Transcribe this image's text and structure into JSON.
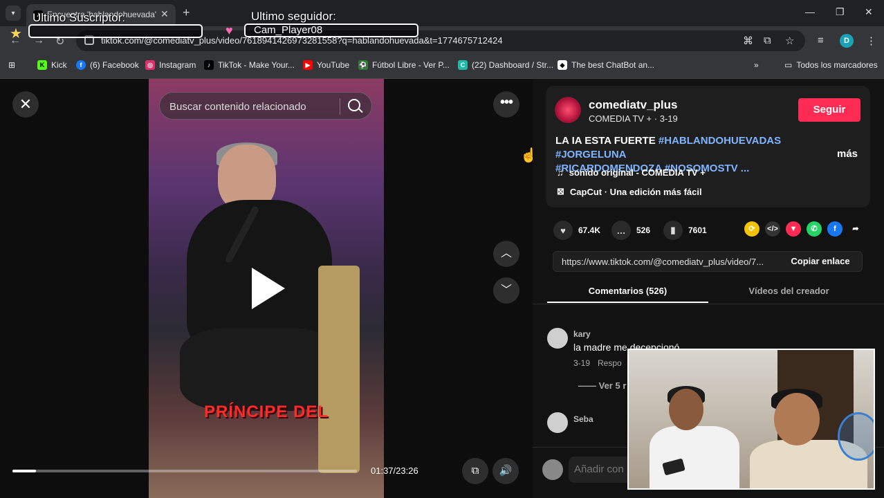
{
  "browser": {
    "tab_title": "Encuentra 'hablandohuevada' e",
    "url": "tiktok.com/@comediatv_plus/video/7618941426973281558?q=hablandohuevada&t=1774675712424",
    "profile_initial": "D"
  },
  "bookmarks": [
    {
      "label": "Kick",
      "color": "#53fc18"
    },
    {
      "label": "(6) Facebook",
      "color": "#1877f2"
    },
    {
      "label": "Instagram",
      "color": "#e1306c"
    },
    {
      "label": "TikTok - Make Your...",
      "color": "#000000"
    },
    {
      "label": "YouTube",
      "color": "#ff0000"
    },
    {
      "label": "Fútbol Libre - Ver P...",
      "color": "#2e7d32"
    },
    {
      "label": "(22) Dashboard / Str...",
      "color": "#1fb9a8"
    },
    {
      "label": "The best ChatBot an...",
      "color": "#ffffff"
    }
  ],
  "bookmarks_all": "Todos los marcadores",
  "overlay": {
    "subscriber_label": "Ultimo Suscriptor:",
    "subscriber_value": "",
    "follower_label": "Ultimo seguidor:",
    "follower_value": "Cam_Player08"
  },
  "video": {
    "search_placeholder": "Buscar contenido relacionado",
    "subtitle": "PRÍNCIPE DEL",
    "time": "01:37/23:26",
    "progress": 0.069
  },
  "author": {
    "name": "comediatv_plus",
    "subtitle": "COMEDIA TV + · 3-19",
    "follow_label": "Seguir"
  },
  "description": {
    "text": "LA IA ESTA FUERTE",
    "tags_line1": "#HABLANDOHUEVADAS #JORGELUNA",
    "tags_line2": "#RICARDOMENDOZA #NOSOMOSTV ...",
    "more": "más"
  },
  "sound": "sonido original - COMEDIA TV +",
  "capcut": "CapCut · Una edición más fácil",
  "stats": {
    "likes": "67.4K",
    "comments": "526",
    "saves": "7601"
  },
  "link": {
    "url": "https://www.tiktok.com/@comediatv_plus/video/7...",
    "copy_label": "Copiar enlace"
  },
  "tabs": {
    "comments": "Comentarios (526)",
    "videos": "Vídeos del creador"
  },
  "comments": [
    {
      "user": "kary",
      "text": "la madre me decepcionó",
      "date": "3-19",
      "reply": "Respo",
      "view_replies": "Ver 5 r"
    },
    {
      "user": "Seba",
      "text": "",
      "date": "",
      "reply": "",
      "view_replies": ""
    }
  ],
  "comment_input_placeholder": "Añadir con"
}
